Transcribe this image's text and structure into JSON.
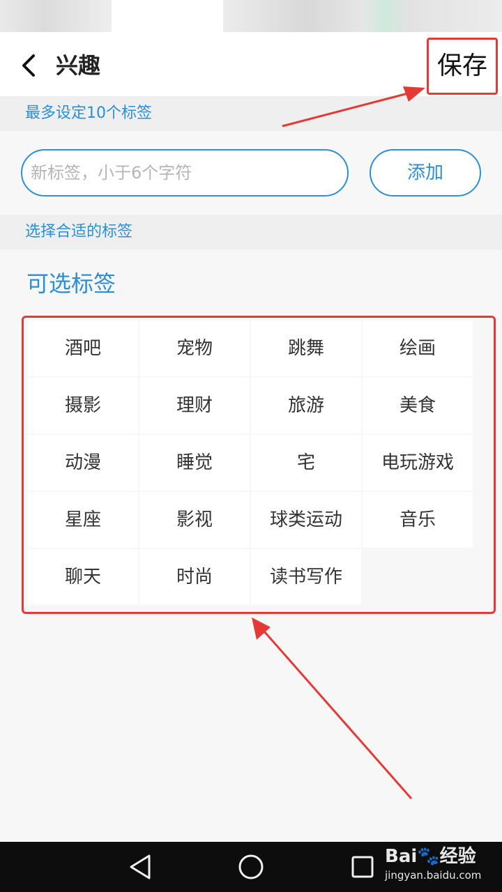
{
  "header": {
    "title": "兴趣",
    "save_label": "保存"
  },
  "custom": {
    "section_label": "最多设定10个标签",
    "input_placeholder": "新标签，小于6个字符",
    "input_value": "",
    "add_label": "添加"
  },
  "choose": {
    "section_label": "选择合适的标签",
    "optional_title": "可选标签",
    "tags": [
      "酒吧",
      "宠物",
      "跳舞",
      "绘画",
      "摄影",
      "理财",
      "旅游",
      "美食",
      "动漫",
      "睡觉",
      "宅",
      "电玩游戏",
      "星座",
      "影视",
      "球类运动",
      "音乐",
      "聊天",
      "时尚",
      "读书写作"
    ]
  },
  "watermark": {
    "logo": "Bai🐾经验",
    "url": "jingyan.baidu.com"
  },
  "colors": {
    "accent": "#2a8fd4",
    "highlight": "#e53935"
  }
}
